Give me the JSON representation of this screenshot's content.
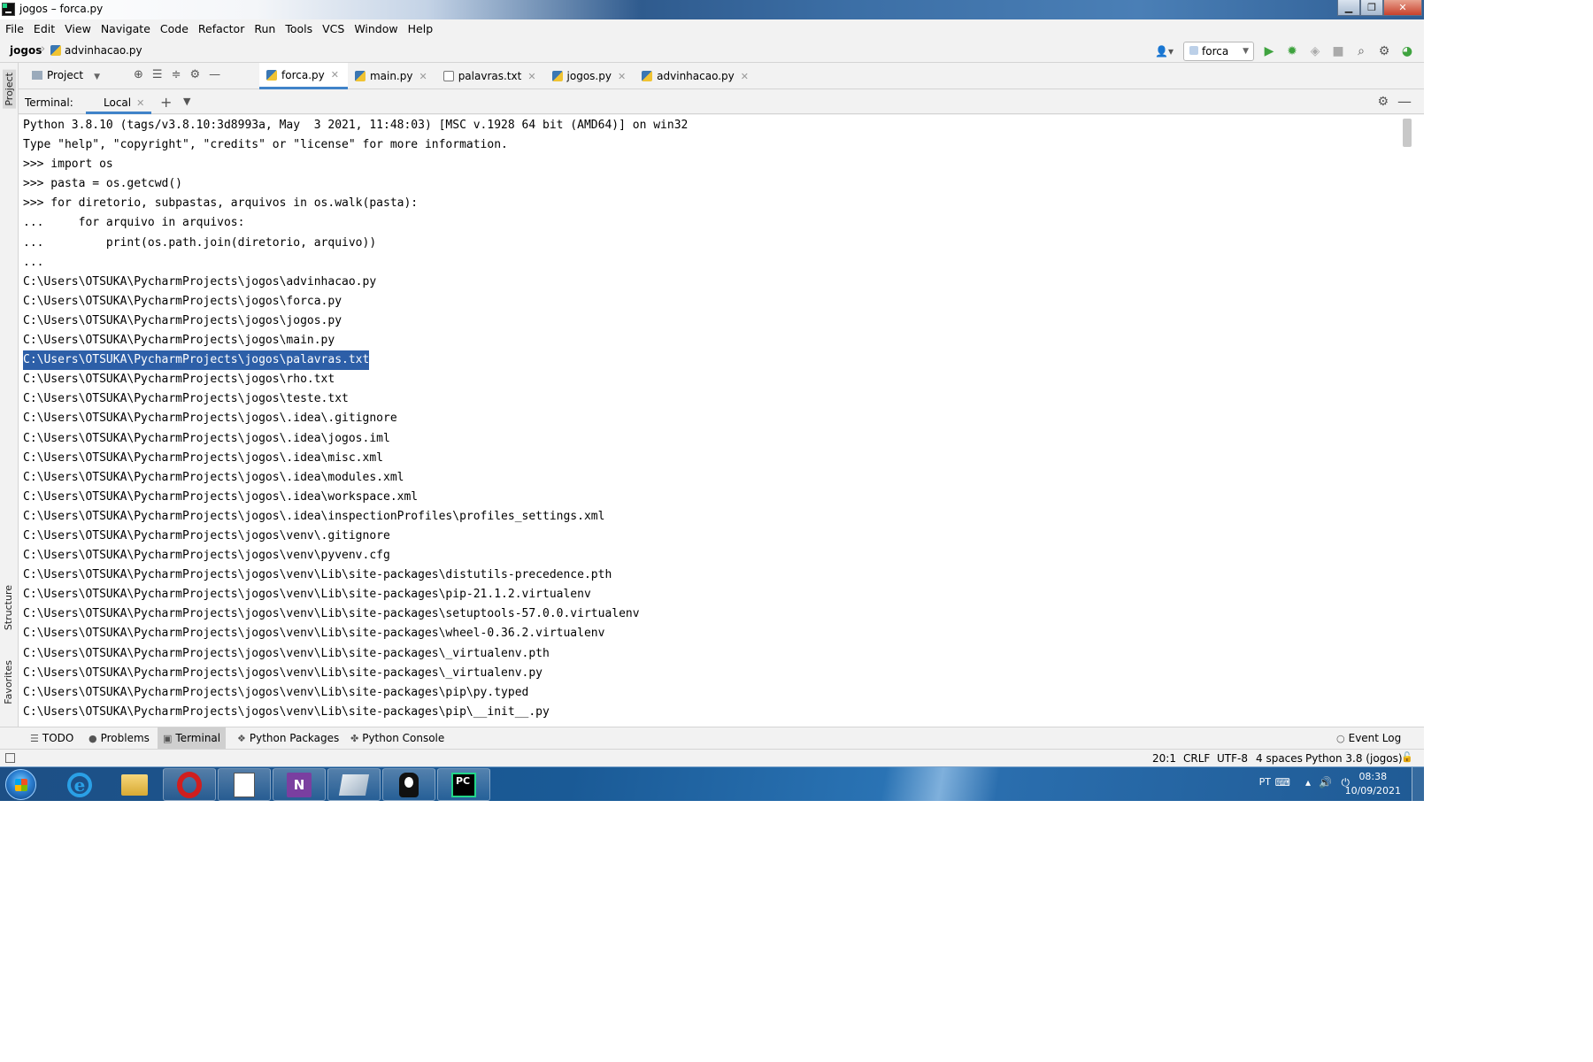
{
  "window": {
    "title": "jogos – forca.py",
    "buttons": {
      "minimize": "▁",
      "maximize": "❐",
      "close": "✕"
    }
  },
  "menu": [
    "File",
    "Edit",
    "View",
    "Navigate",
    "Code",
    "Refactor",
    "Run",
    "Tools",
    "VCS",
    "Window",
    "Help"
  ],
  "breadcrumb": {
    "project": "jogos",
    "file": "advinhacao.py"
  },
  "run_config": {
    "name": "forca"
  },
  "sidebar": {
    "project": "Project",
    "structure": "Structure",
    "favorites": "Favorites"
  },
  "project_panel": {
    "label": "Project"
  },
  "editor_tabs": [
    {
      "label": "forca.py",
      "icon": "python-file-icon",
      "active": true
    },
    {
      "label": "main.py",
      "icon": "python-file-icon",
      "active": false
    },
    {
      "label": "palavras.txt",
      "icon": "text-file-icon",
      "active": false
    },
    {
      "label": "jogos.py",
      "icon": "python-file-icon",
      "active": false
    },
    {
      "label": "advinhacao.py",
      "icon": "python-file-icon",
      "active": false
    }
  ],
  "terminal": {
    "label": "Terminal:",
    "tab": "Local",
    "selected_line_index": 13,
    "lines": [
      "Python 3.8.10 (tags/v3.8.10:3d8993a, May  3 2021, 11:48:03) [MSC v.1928 64 bit (AMD64)] on win32",
      "Type \"help\", \"copyright\", \"credits\" or \"license\" for more information.",
      ">>> import os",
      ">>> pasta = os.getcwd()",
      ">>> for diretorio, subpastas, arquivos in os.walk(pasta):",
      "...     for arquivo in arquivos:",
      "...         print(os.path.join(diretorio, arquivo))",
      "...",
      "C:\\Users\\OTSUKA\\PycharmProjects\\jogos\\advinhacao.py",
      "C:\\Users\\OTSUKA\\PycharmProjects\\jogos\\forca.py",
      "C:\\Users\\OTSUKA\\PycharmProjects\\jogos\\jogos.py",
      "C:\\Users\\OTSUKA\\PycharmProjects\\jogos\\main.py",
      "C:\\Users\\OTSUKA\\PycharmProjects\\jogos\\palavras.txt",
      "C:\\Users\\OTSUKA\\PycharmProjects\\jogos\\rho.txt",
      "C:\\Users\\OTSUKA\\PycharmProjects\\jogos\\teste.txt",
      "C:\\Users\\OTSUKA\\PycharmProjects\\jogos\\.idea\\.gitignore",
      "C:\\Users\\OTSUKA\\PycharmProjects\\jogos\\.idea\\jogos.iml",
      "C:\\Users\\OTSUKA\\PycharmProjects\\jogos\\.idea\\misc.xml",
      "C:\\Users\\OTSUKA\\PycharmProjects\\jogos\\.idea\\modules.xml",
      "C:\\Users\\OTSUKA\\PycharmProjects\\jogos\\.idea\\workspace.xml",
      "C:\\Users\\OTSUKA\\PycharmProjects\\jogos\\.idea\\inspectionProfiles\\profiles_settings.xml",
      "C:\\Users\\OTSUKA\\PycharmProjects\\jogos\\venv\\.gitignore",
      "C:\\Users\\OTSUKA\\PycharmProjects\\jogos\\venv\\pyvenv.cfg",
      "C:\\Users\\OTSUKA\\PycharmProjects\\jogos\\venv\\Lib\\site-packages\\distutils-precedence.pth",
      "C:\\Users\\OTSUKA\\PycharmProjects\\jogos\\venv\\Lib\\site-packages\\pip-21.1.2.virtualenv",
      "C:\\Users\\OTSUKA\\PycharmProjects\\jogos\\venv\\Lib\\site-packages\\setuptools-57.0.0.virtualenv",
      "C:\\Users\\OTSUKA\\PycharmProjects\\jogos\\venv\\Lib\\site-packages\\wheel-0.36.2.virtualenv",
      "C:\\Users\\OTSUKA\\PycharmProjects\\jogos\\venv\\Lib\\site-packages\\_virtualenv.pth",
      "C:\\Users\\OTSUKA\\PycharmProjects\\jogos\\venv\\Lib\\site-packages\\_virtualenv.py",
      "C:\\Users\\OTSUKA\\PycharmProjects\\jogos\\venv\\Lib\\site-packages\\pip\\py.typed",
      "C:\\Users\\OTSUKA\\PycharmProjects\\jogos\\venv\\Lib\\site-packages\\pip\\__init__.py"
    ]
  },
  "bottom_tabs": [
    {
      "label": "TODO",
      "icon": "list-icon",
      "active": false
    },
    {
      "label": "Problems",
      "icon": "problems-icon",
      "active": false
    },
    {
      "label": "Terminal",
      "icon": "terminal-icon",
      "active": true
    },
    {
      "label": "Python Packages",
      "icon": "packages-icon",
      "active": false
    },
    {
      "label": "Python Console",
      "icon": "console-icon",
      "active": false
    }
  ],
  "event_log": "Event Log",
  "status": {
    "position": "20:1",
    "line_ending": "CRLF",
    "encoding": "UTF-8",
    "indent": "4 spaces",
    "interpreter": "Python 3.8 (jogos)"
  },
  "taskbar": {
    "language": "PT",
    "time": "08:38",
    "date": "10/09/2021",
    "apps": [
      "internet-explorer-icon",
      "file-explorer-icon",
      "opera-icon",
      "notepad-icon",
      "onenote-icon",
      "tablet-icon",
      "lamp-icon",
      "pycharm-icon"
    ]
  },
  "colors": {
    "selection": "#2d5fa8",
    "active_tab_underline": "#4083c9",
    "run_green": "#3fa33f"
  }
}
